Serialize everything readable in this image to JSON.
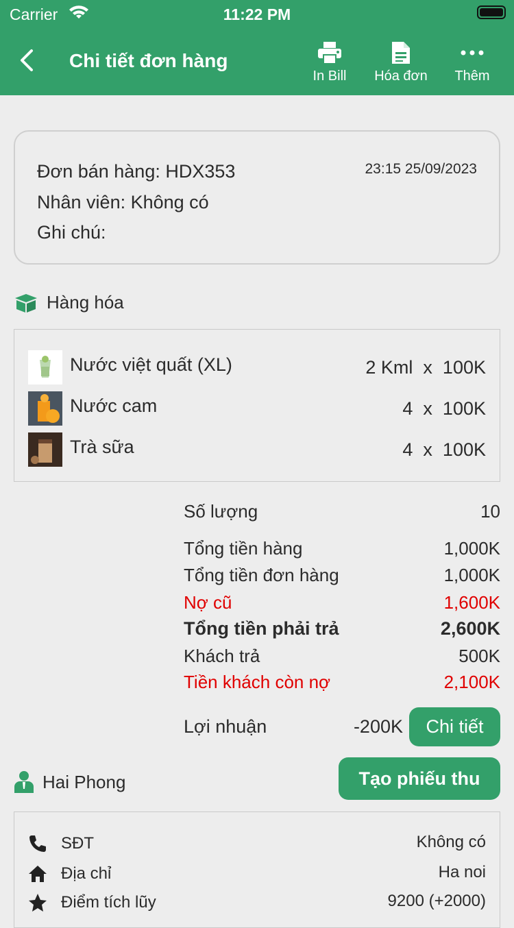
{
  "status_bar": {
    "carrier": "Carrier",
    "time": "11:22 PM"
  },
  "header": {
    "title": "Chi tiết đơn hàng",
    "actions": [
      {
        "label": "In Bill",
        "icon": "printer-icon"
      },
      {
        "label": "Hóa đơn",
        "icon": "document-icon"
      },
      {
        "label": "Thêm",
        "icon": "more-icon"
      }
    ]
  },
  "order": {
    "code_line": "Đơn bán hàng: HDX353",
    "datetime": "23:15 25/09/2023",
    "staff_line": "Nhân viên: Không có",
    "note_line": "Ghi chú:"
  },
  "goods": {
    "section_title": "Hàng hóa",
    "items": [
      {
        "name": "Nước việt quất (XL)",
        "qty": "2 Kml  x  100K"
      },
      {
        "name": "Nước cam",
        "qty": "4  x  100K"
      },
      {
        "name": "Trà sữa",
        "qty": "4  x  100K"
      }
    ]
  },
  "summary": {
    "quantity_label": "Số lượng",
    "quantity_value": "10",
    "goods_total_label": "Tổng tiền hàng",
    "goods_total_value": "1,000K",
    "order_total_label": "Tổng tiền đơn hàng",
    "order_total_value": "1,000K",
    "old_debt_label": "Nợ cũ",
    "old_debt_value": "1,600K",
    "payable_label": "Tổng tiền phải trả",
    "payable_value": "2,600K",
    "paid_label": "Khách trả",
    "paid_value": "500K",
    "remaining_label": "Tiền khách còn nợ",
    "remaining_value": "2,100K",
    "profit_label": "Lợi nhuận",
    "profit_value": "-200K",
    "detail_button": "Chi tiết"
  },
  "customer": {
    "name": "Hai Phong",
    "create_receipt_button": "Tạo phiếu thu",
    "rows": [
      {
        "label": "SĐT",
        "value": "Không có"
      },
      {
        "label": "Địa chỉ",
        "value": "Ha noi"
      },
      {
        "label": "Điểm tích lũy",
        "value": "9200 (+2000)"
      }
    ]
  },
  "colors": {
    "brand": "#33a06a",
    "debt": "#e00000",
    "background": "#ededed"
  }
}
